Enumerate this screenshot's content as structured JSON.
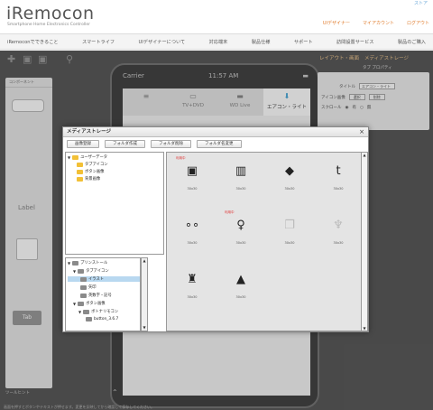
{
  "header": {
    "logo": "iRemocon",
    "tagline": "Smartphone Home Electronics Controller",
    "top_link": "ストア",
    "links": [
      "UIデザイナー",
      "マイアカウント",
      "ログアウト"
    ]
  },
  "nav": {
    "items": [
      "iRemoconでできること",
      "スマートライフ",
      "UIデザイナーについて",
      "対応端末",
      "製品仕様",
      "サポート",
      "訪問設置サービス",
      "製品のご購入"
    ]
  },
  "workspace": {
    "toolbar_icons": [
      "add-icon",
      "save-icon",
      "save-as-icon",
      "zoom-icon"
    ],
    "components_title": "コンポーネント",
    "label_text": "Label",
    "tab_text": "Tab",
    "bottom_text": "ツールヒント",
    "bottom_note": "画面を押すとボタンやテキストが押せます。変更を反映してから確認して保存してください。"
  },
  "phone": {
    "carrier": "Carrier",
    "time": "11:57 AM",
    "tabs": [
      {
        "icon": "≡",
        "label": ""
      },
      {
        "icon": "▭",
        "label": "TV+DVD"
      },
      {
        "icon": "▬",
        "label": "WD Live"
      },
      {
        "icon": "⬇",
        "label": "エアコン・ライト"
      }
    ]
  },
  "properties": {
    "tabs": [
      "レイアウト・画面",
      "メディアストレージ"
    ],
    "subtitle": "タブ プロパティ",
    "title_label": "タイトル",
    "title_value": "エアコン・ライト",
    "icon_label": "アイコン画像",
    "icon_select": "選択",
    "icon_delete": "削除",
    "scroll_label": "スクロール",
    "scroll_on": "有",
    "scroll_off": "無"
  },
  "modal": {
    "title": "メディアストレージ",
    "close": "×",
    "buttons": [
      "画像登録",
      "フォルダ作成",
      "フォルダ削除",
      "フォルダ名変更"
    ],
    "tree_top": [
      {
        "label": "ユーザーデータ",
        "level": 0,
        "toggle": "▼"
      },
      {
        "label": "タブアイコン",
        "level": 1,
        "toggle": ""
      },
      {
        "label": "ボタン画像",
        "level": 1,
        "toggle": ""
      },
      {
        "label": "背景画像",
        "level": 1,
        "toggle": ""
      }
    ],
    "tree_bottom": [
      {
        "label": "プリンストール",
        "level": 0,
        "toggle": "▼",
        "selected": false
      },
      {
        "label": "タブアイコン",
        "level": 1,
        "toggle": "▼",
        "selected": false
      },
      {
        "label": "イラスト",
        "level": 2,
        "toggle": "",
        "selected": true
      },
      {
        "label": "矢印",
        "level": 2,
        "toggle": "",
        "selected": false
      },
      {
        "label": "英数字・記号",
        "level": 2,
        "toggle": "",
        "selected": false
      },
      {
        "label": "ボタン画像",
        "level": 1,
        "toggle": "▼",
        "selected": false
      },
      {
        "label": "ボトナリモコン",
        "level": 2,
        "toggle": "▼",
        "selected": false
      },
      {
        "label": "button_3.6.7",
        "level": 3,
        "toggle": "",
        "selected": false
      }
    ],
    "grid": [
      {
        "icon": "tv-icon",
        "glyph": "▣",
        "size": "30x30",
        "tag": "利用中",
        "light": false
      },
      {
        "icon": "router-icon",
        "glyph": "▥",
        "size": "30x30",
        "tag": "",
        "light": false
      },
      {
        "icon": "tag-icon",
        "glyph": "◆",
        "size": "30x30",
        "tag": "",
        "light": false
      },
      {
        "icon": "twitter-icon",
        "glyph": "t",
        "size": "30x30",
        "tag": "",
        "light": false
      },
      {
        "icon": "oo-icon",
        "glyph": "∘∘",
        "size": "30x30",
        "tag": "",
        "light": false
      },
      {
        "icon": "bulb-icon",
        "glyph": "♀",
        "size": "30x30",
        "tag": "利用中",
        "light": false
      },
      {
        "icon": "copy-icon",
        "glyph": "❐",
        "size": "30x30",
        "tag": "",
        "light": true
      },
      {
        "icon": "lamp-icon",
        "glyph": "♆",
        "size": "30x30",
        "tag": "",
        "light": true
      },
      {
        "icon": "desk-lamp-icon",
        "glyph": "♜",
        "size": "30x30",
        "tag": "",
        "light": false
      },
      {
        "icon": "pendant-lamp-icon",
        "glyph": "▲",
        "size": "30x30",
        "tag": "",
        "light": false
      }
    ]
  }
}
